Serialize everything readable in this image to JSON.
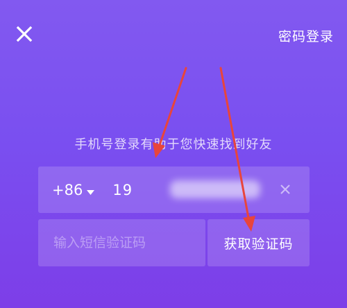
{
  "header": {
    "close_icon": "close-icon",
    "password_login_label": "密码登录"
  },
  "hint_text": "手机号登录有助于您快速找到好友",
  "phone": {
    "country_code": "+86",
    "dropdown_icon": "caret-down-icon",
    "value": "19",
    "clear_icon": "clear-icon"
  },
  "sms": {
    "placeholder": "输入短信验证码",
    "get_code_label": "获取验证码"
  },
  "annotation": {
    "arrow_color": "#e8453c"
  },
  "colors": {
    "background_top": "#8259f0",
    "background_bottom": "#7d3ee8"
  }
}
